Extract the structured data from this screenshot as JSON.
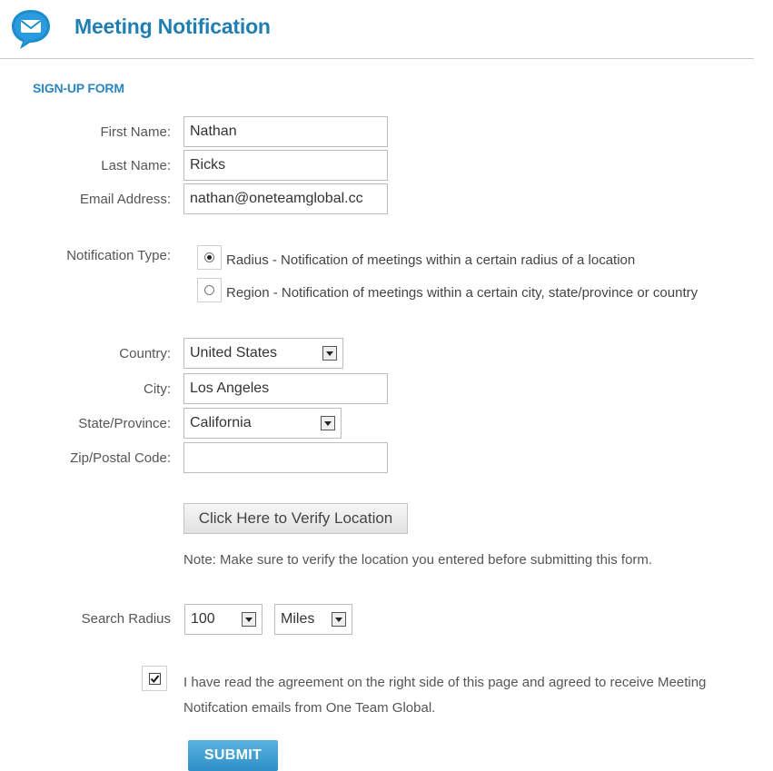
{
  "header": {
    "title": "Meeting Notification"
  },
  "section_title": "SIGN-UP FORM",
  "fields": {
    "first_name": {
      "label": "First Name:",
      "value": "Nathan"
    },
    "last_name": {
      "label": "Last Name:",
      "value": "Ricks"
    },
    "email": {
      "label": "Email Address:",
      "value": "nathan@oneteamglobal.cc"
    },
    "notification_type": {
      "label": "Notification Type:",
      "options": [
        {
          "label": "Radius - Notification of meetings within a certain radius of a location",
          "selected": true
        },
        {
          "label": "Region - Notification of meetings within a certain city, state/province or country",
          "selected": false
        }
      ]
    },
    "country": {
      "label": "Country:",
      "value": "United States"
    },
    "city": {
      "label": "City:",
      "value": "Los Angeles"
    },
    "state": {
      "label": "State/Province:",
      "value": "California"
    },
    "zip": {
      "label": "Zip/Postal Code:",
      "value": ""
    },
    "search_radius": {
      "label": "Search Radius",
      "value": "100",
      "unit": "Miles"
    }
  },
  "verify_button": "Click Here to Verify Location",
  "note": "Note: Make sure to verify the location you entered before submitting this form.",
  "agreement": {
    "checked": true,
    "text": "I have read the agreement on the right side of this page and agreed to receive Meeting Notifcation emails from One Team Global."
  },
  "submit_button": "SUBMIT",
  "colors": {
    "brand": "#1f7fb3",
    "section": "#2a86c0",
    "submit": "#3a9bd0"
  }
}
